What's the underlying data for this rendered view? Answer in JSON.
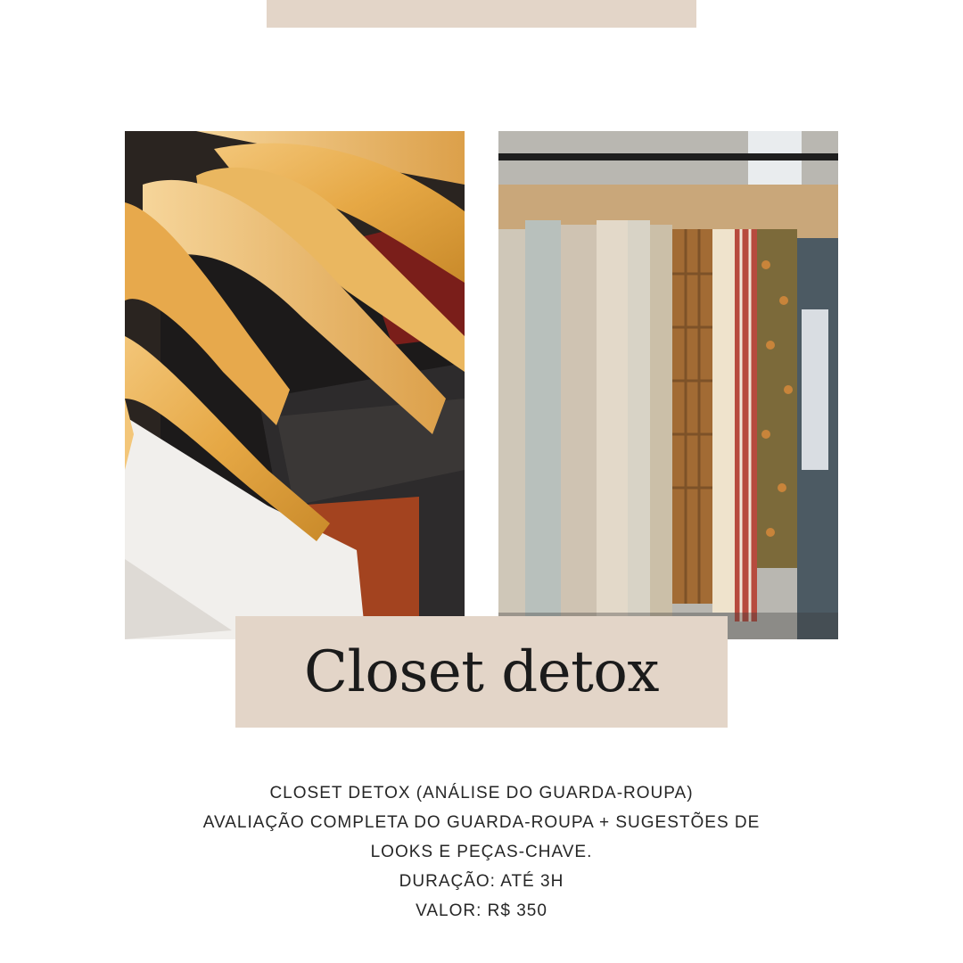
{
  "title": "Closet detox",
  "description": {
    "line1": "CLOSET DETOX (ANÁLISE DO GUARDA-ROUPA)",
    "line2": "AVALIAÇÃO COMPLETA DO GUARDA-ROUPA + SUGESTÕES DE",
    "line3": "LOOKS E PEÇAS-CHAVE.",
    "line4": "DURAÇÃO: ATÉ 3H",
    "line5": "VALOR: R$ 350"
  },
  "colors": {
    "accent_band": "#e3d5c8",
    "text": "#262626",
    "background": "#ffffff"
  }
}
